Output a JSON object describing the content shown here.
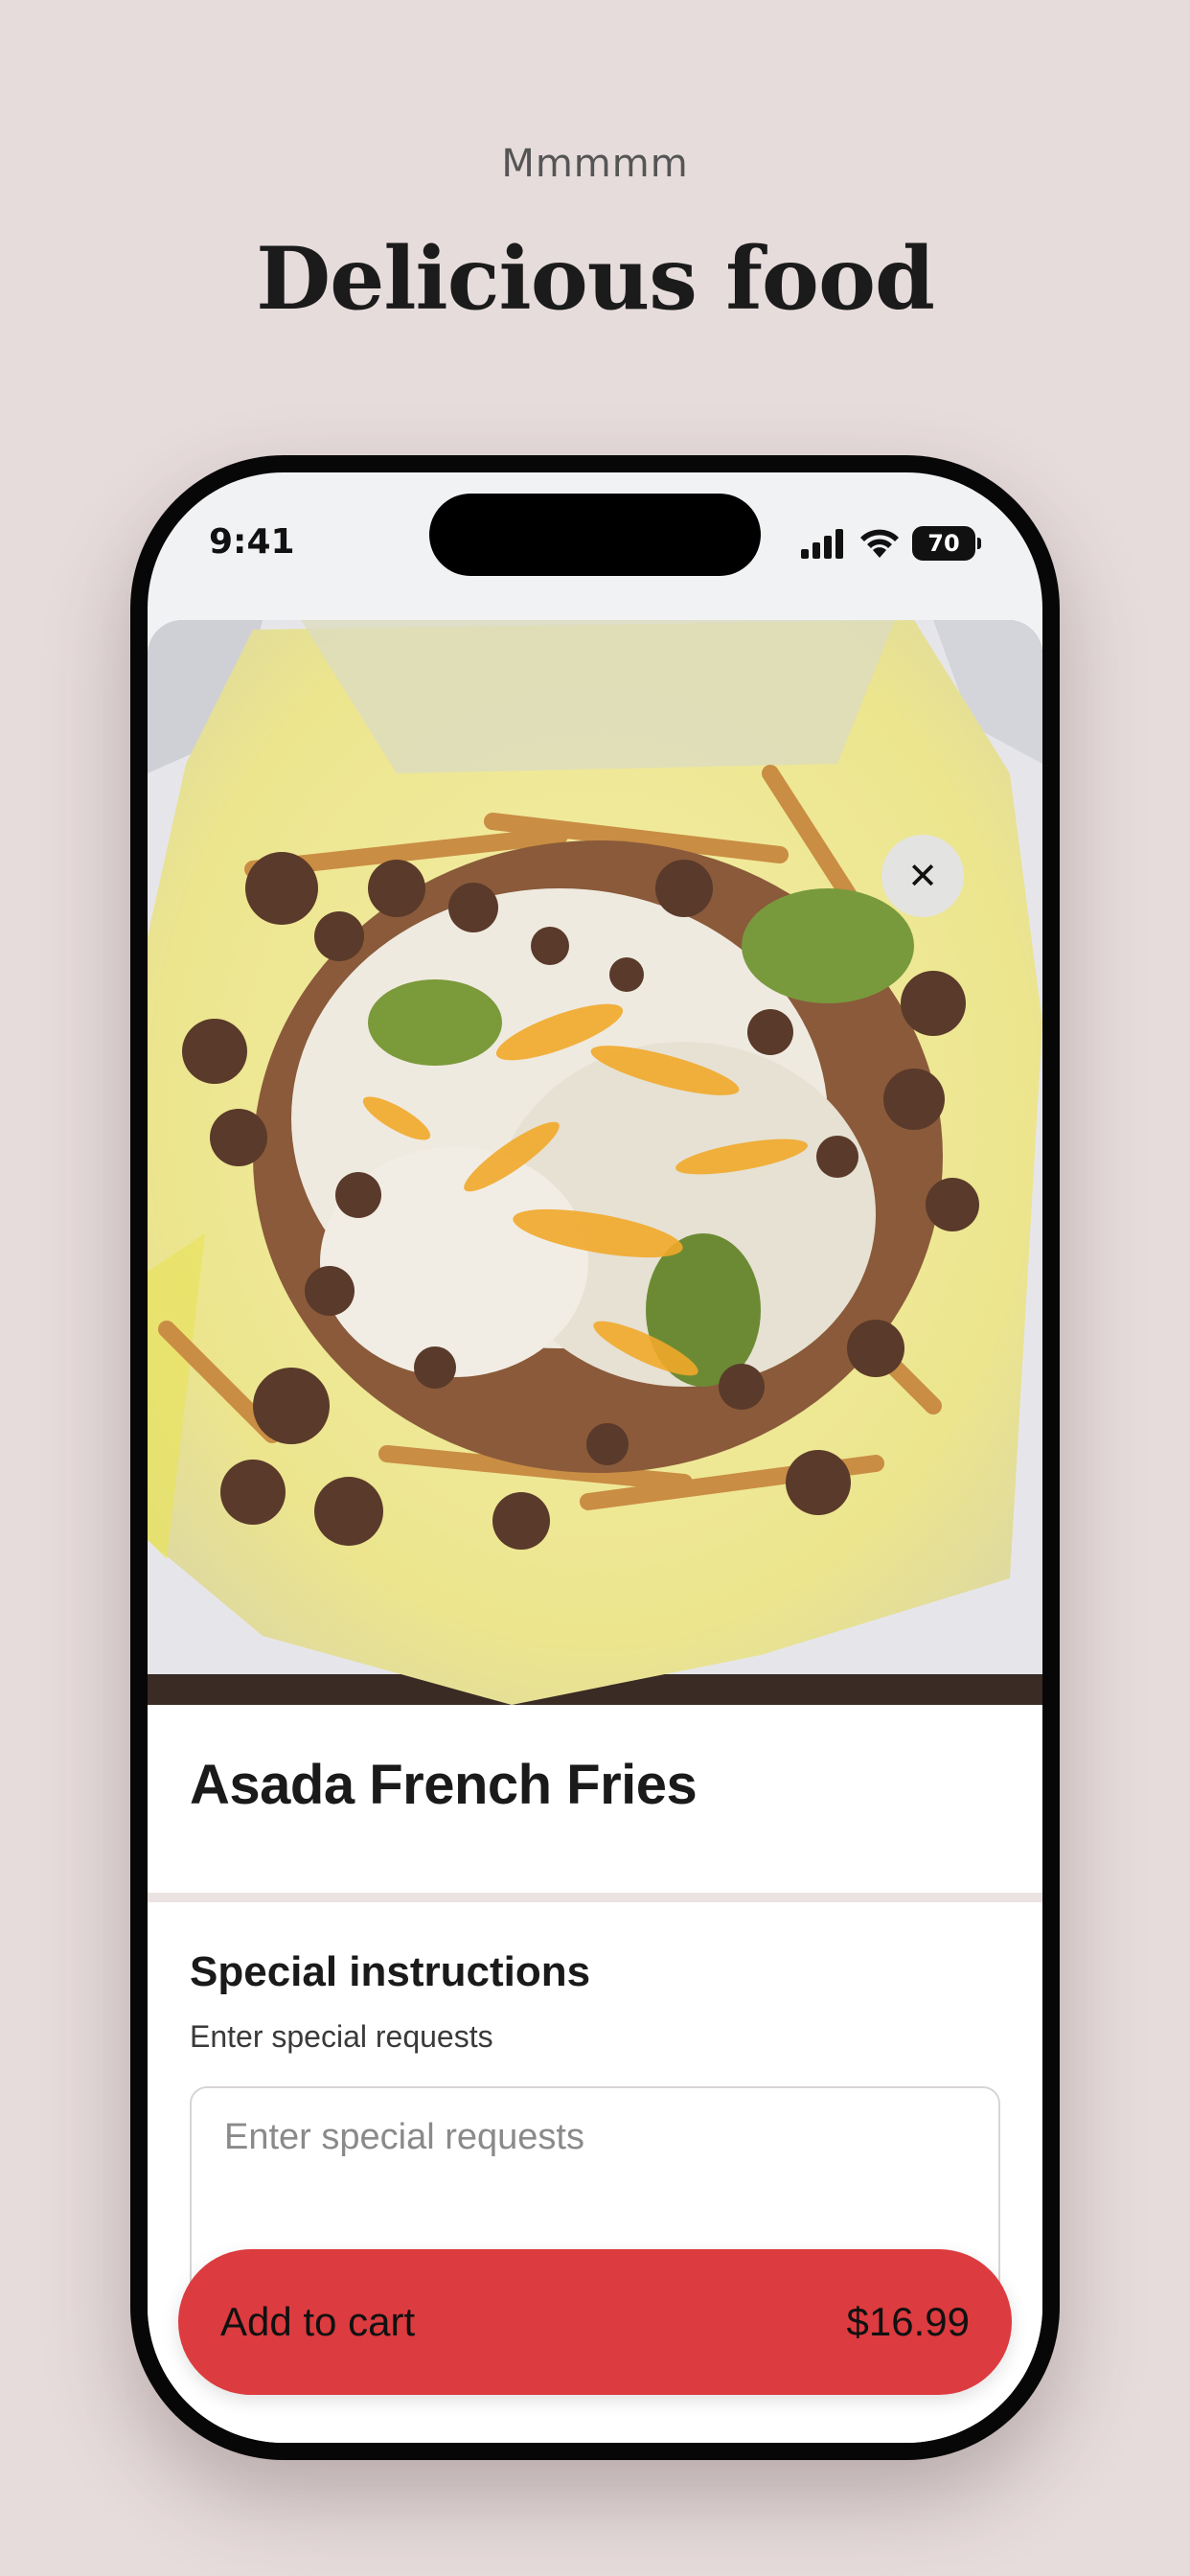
{
  "header": {
    "eyebrow": "Mmmmm",
    "headline": "Delicious food"
  },
  "status_bar": {
    "time": "9:41",
    "battery": "70"
  },
  "item": {
    "name": "Asada French Fries",
    "image": "asada-french-fries-photo"
  },
  "special_instructions": {
    "title": "Special instructions",
    "subtitle": "Enter special requests",
    "placeholder": "Enter special requests",
    "value": ""
  },
  "cart_button": {
    "label": "Add to cart",
    "price": "$16.99"
  },
  "colors": {
    "background": "#e7dcdc",
    "accent_red": "#dc3b3f",
    "divider": "#ebe3e1"
  },
  "icons": {
    "close": "close-icon",
    "signal": "cellular-signal-icon",
    "wifi": "wifi-icon",
    "battery": "battery-icon"
  }
}
